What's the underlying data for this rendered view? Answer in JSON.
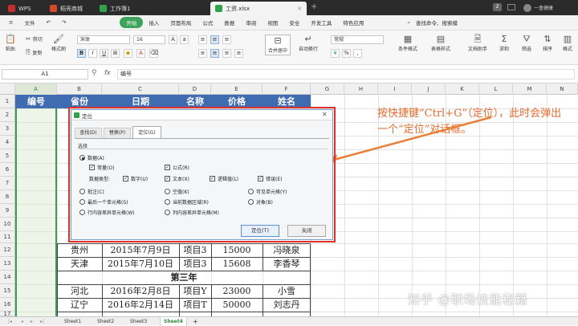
{
  "titlebar": {
    "tabs": [
      {
        "label": "WPS",
        "icon": "wps-logo-icon",
        "color": "#c62d2d"
      },
      {
        "label": "稻壳商城",
        "icon": "docer-icon",
        "color": "#d64b2c"
      },
      {
        "label": "工作簿1",
        "icon": "spreadsheet-icon",
        "color": "#2fa24b"
      },
      {
        "label": "工资.xlsx",
        "icon": "spreadsheet-icon",
        "color": "#2fa24b"
      }
    ],
    "badge": "2",
    "user": "一盒健康"
  },
  "menubar": {
    "file": "文件",
    "items": [
      "开始",
      "插入",
      "页面布局",
      "公式",
      "数据",
      "审阅",
      "视图",
      "安全",
      "开发工具",
      "特色应用"
    ],
    "search": "查找命令、搜索模"
  },
  "ribbon": {
    "paste": "粘贴",
    "cut": "剪切",
    "copy": "复制",
    "format_painter": "格式刷",
    "font_name": "宋体",
    "font_size": "16",
    "merge": "合并居中",
    "wrap": "自动换行",
    "number_format": "常规",
    "conditional": "条件格式",
    "table_style": "表格样式",
    "doc_helper": "文档助手",
    "sum": "求和",
    "filter": "筛选",
    "sort": "排序",
    "format": "格式"
  },
  "formula_bar": {
    "cell_ref": "A1",
    "fx": "fx",
    "content": "编号"
  },
  "grid": {
    "columns": [
      "A",
      "B",
      "C",
      "D",
      "E",
      "F",
      "G",
      "H",
      "I",
      "J",
      "K",
      "L",
      "M",
      "N"
    ],
    "rows": [
      "1",
      "2",
      "3",
      "4",
      "5",
      "6",
      "7",
      "8",
      "9",
      "10",
      "11",
      "12",
      "13",
      "14",
      "15",
      "16",
      "17"
    ],
    "headers": [
      "编号",
      "省份",
      "日期",
      "名称",
      "价格",
      "姓名"
    ],
    "data_rows": [
      [
        "",
        "贵州",
        "2015年7月9日",
        "项目3",
        "15000",
        "冯晓泉"
      ],
      [
        "",
        "天津",
        "2015年7月10日",
        "项目3",
        "15608",
        "李香琴"
      ],
      [
        "",
        "",
        "第三年",
        "",
        "",
        ""
      ],
      [
        "",
        "河北",
        "2016年2月8日",
        "项目Y",
        "23000",
        "小雪"
      ],
      [
        "",
        "辽宁",
        "2016年2月14日",
        "项目T",
        "50000",
        "刘志丹"
      ]
    ]
  },
  "dialog": {
    "title": "定位",
    "tabs": [
      "查找(D)",
      "替换(P)",
      "定位(G)"
    ],
    "section": "选择",
    "data_option": "数据(A)",
    "constant": "常量(O)",
    "formula": "公式(R)",
    "data_type_label": "数据类型:",
    "types": [
      "数字(U)",
      "文本(X)",
      "逻辑值(L)",
      "错误(E)"
    ],
    "options_col1": [
      "批注(C)",
      "最后一个单元格(S)",
      "行内容差异单元格(W)"
    ],
    "options_col2": [
      "空值(K)",
      "当前数据区域(R)",
      "列内容差异单元格(M)"
    ],
    "options_col3": [
      "可见单元格(Y)",
      "对象(B)"
    ],
    "ok": "定位(T)",
    "close": "关闭"
  },
  "annotation": {
    "text": "按快捷键“Ctrl+G”（定位），此时会弹出一个“定位”对话框。",
    "color": "#e36b2e"
  },
  "watermark": "知乎 @职场技能秘籍",
  "sheets": [
    "Sheet1",
    "Sheet2",
    "Sheet3",
    "Sheet4",
    "+"
  ],
  "colors": {
    "header_blue": "#3f6bb0",
    "accent_green": "#3ca35b",
    "dialog_highlight": "#e0302a"
  }
}
